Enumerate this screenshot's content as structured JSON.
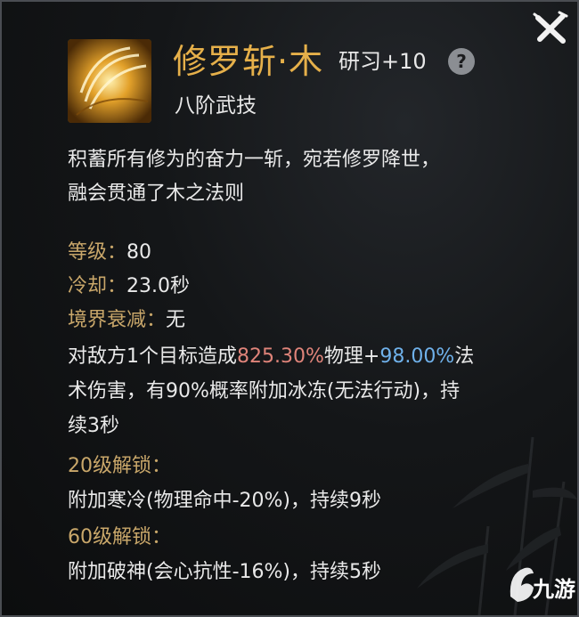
{
  "skill": {
    "name": "修罗斩·木",
    "study": "研习+10",
    "help": "?",
    "rank": "八阶武技"
  },
  "description": {
    "line1": "积蓄所有修为的奋力一斩，宛若修罗降世，",
    "line2": "融会贯通了木之法则"
  },
  "stats": {
    "level_label": "等级：",
    "level_value": "80",
    "cooldown_label": "冷却：",
    "cooldown_value": "23.0秒",
    "realm_label": "境界衰减：",
    "realm_value": "无"
  },
  "effect": {
    "prefix": "对敌方1个目标造成",
    "physical_pct": "825.30%",
    "mid": "物理+",
    "magic_pct": "98.00%",
    "suffix": "法",
    "line2": "术伤害，有90%概率附加冰冻(无法行动)，持",
    "line3": "续3秒"
  },
  "unlocks": [
    {
      "title": "20级解锁：",
      "text": "附加寒冷(物理命中-20%)，持续9秒"
    },
    {
      "title": "60级解锁：",
      "text": "附加破神(会心抗性-16%)，持续5秒"
    }
  ],
  "watermark": "九游",
  "colors": {
    "title_gold": "#e6b04a",
    "label_tan": "#c9a76a",
    "physical_red": "#e0847a",
    "magic_blue": "#6fb1ea"
  }
}
